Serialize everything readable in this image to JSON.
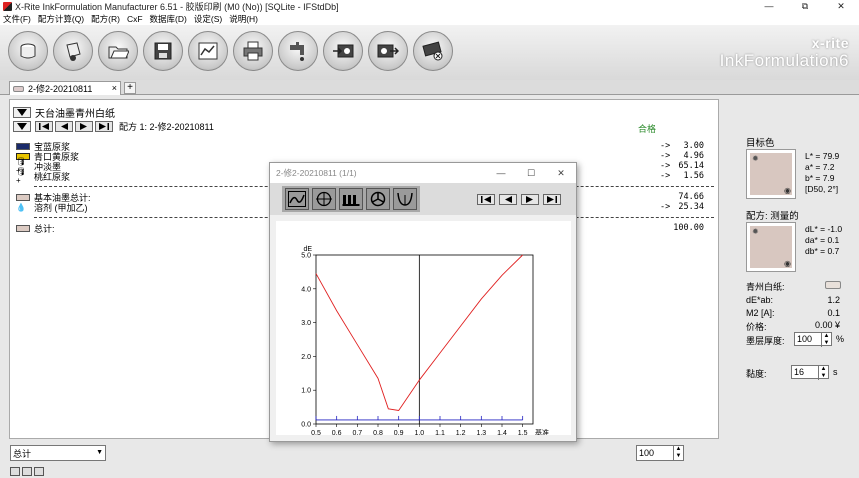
{
  "window": {
    "title": "X-Rite InkFormulation Manufacturer 6.51 - 胶版印刷 (M0 (No))   [SQLite - IFStdDb]",
    "minimize": "—",
    "maximize": "⧉",
    "close": "✕"
  },
  "menu": [
    "文件(F)",
    "配方计算(Q)",
    "配方(R)",
    "CxF",
    "数据库(D)",
    "设定(S)",
    "说明(H)"
  ],
  "toolbar": {
    "buttons": [
      "ink-can-icon",
      "ink-pour-icon",
      "folder-open-icon",
      "save-icon",
      "chart-icon",
      "print-icon",
      "tap-icon",
      "import-device-icon",
      "export-device-icon",
      "cancel-device-icon"
    ]
  },
  "brand": {
    "line1": "x-rite",
    "line2": "InkFormulation6"
  },
  "tabs": [
    {
      "label": "2-修2-20210811",
      "close": "×"
    }
  ],
  "tab_add": "+",
  "formula": {
    "name": "天台油墨青州白纸",
    "recipe_label": "配方 1: 2-修2-20210811",
    "status": "合格",
    "ingredients": [
      {
        "name": "宝蓝原浆",
        "arrow": "->",
        "value": "3.00",
        "color": "#1a2a6a",
        "kind": "swatch"
      },
      {
        "name": "青口黄原浆",
        "arrow": "->",
        "value": "4.96",
        "color": "#e8c400",
        "kind": "swatch"
      },
      {
        "name": "冲淡墨",
        "arrow": "->",
        "value": "65.14",
        "color": "#dddddd",
        "kind": "ink"
      },
      {
        "name": "桃红原浆",
        "arrow": "->",
        "value": "1.56",
        "color": "#dddddd",
        "kind": "ink"
      }
    ],
    "base_total": {
      "name": "基本油墨总计:",
      "value": "74.66"
    },
    "solvent": {
      "name": "溶剂 (甲加乙)",
      "arrow": "->",
      "value": "25.34"
    },
    "total": {
      "name": "总计:",
      "value": "100.00"
    }
  },
  "bottom": {
    "select": "总计",
    "amount": "100"
  },
  "target": {
    "label": "目标色",
    "L": "L* = 79.9",
    "a": "a* = 7.2",
    "b": "b* = 7.9",
    "illum": "[D50, 2°]",
    "color": "#d8c7c0"
  },
  "measured": {
    "label": "配方: 测量的",
    "dL": "dL* = -1.0",
    "da": "da* = 0.1",
    "db": "db* = 0.7",
    "color": "#d8c7c0"
  },
  "substrate": {
    "label": "青州白纸:"
  },
  "props": [
    {
      "label": "dE*ab:",
      "value": "1.2"
    },
    {
      "label": "M2 [A]:",
      "value": "0.1"
    },
    {
      "label": "价格:",
      "value": "0.00 ¥"
    }
  ],
  "thickness": {
    "label": "墨层厚度:",
    "value": "100",
    "unit": "%"
  },
  "viscosity": {
    "label": "黏度:",
    "value": "16",
    "unit": "s"
  },
  "dialog": {
    "title": "2-修2-20210811    (1/1)",
    "min": "—",
    "max": "☐",
    "close": "✕"
  },
  "chart_data": {
    "type": "line",
    "title": "",
    "xlabel": "基准",
    "ylabel": "dE",
    "xlim": [
      0.5,
      1.55
    ],
    "ylim": [
      0.0,
      5.0
    ],
    "x_ticks": [
      "0.5",
      "0.6",
      "0.7",
      "0.8",
      "0.9",
      "1.0",
      "1.1",
      "1.2",
      "1.3",
      "1.4",
      "1.5"
    ],
    "y_ticks": [
      "0.0",
      "1.0",
      "2.0",
      "3.0",
      "4.0",
      "5.0"
    ],
    "reference_x": 1.0,
    "series": [
      {
        "color": "#e02020",
        "x": [
          0.5,
          0.6,
          0.7,
          0.8,
          0.85,
          0.9,
          1.0,
          1.1,
          1.2,
          1.3,
          1.4,
          1.5
        ],
        "y": [
          4.45,
          3.35,
          2.35,
          1.35,
          0.45,
          0.4,
          1.3,
          2.1,
          2.9,
          3.7,
          4.4,
          5.0
        ]
      },
      {
        "color": "#2020c0",
        "x": [
          0.5,
          1.5
        ],
        "y": [
          0.12,
          0.12
        ]
      }
    ]
  }
}
